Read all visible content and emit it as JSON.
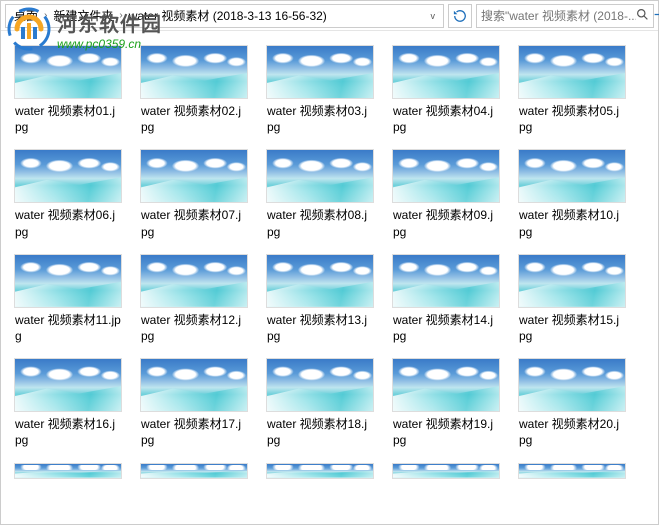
{
  "breadcrumb": {
    "items": [
      "桌面",
      "新建文件夹",
      "water 视频素材 (2018-3-13 16-56-32)"
    ]
  },
  "search": {
    "placeholder": "搜索\"water 视频素材 (2018-..."
  },
  "watermark": {
    "title": "河东软件园",
    "url": "www.pc0359.cn"
  },
  "files": [
    {
      "name": "water 视频素材01.jpg"
    },
    {
      "name": "water 视频素材02.jpg"
    },
    {
      "name": "water 视频素材03.jpg"
    },
    {
      "name": "water 视频素材04.jpg"
    },
    {
      "name": "water 视频素材05.jpg"
    },
    {
      "name": "water 视频素材06.jpg"
    },
    {
      "name": "water 视频素材07.jpg"
    },
    {
      "name": "water 视频素材08.jpg"
    },
    {
      "name": "water 视频素材09.jpg"
    },
    {
      "name": "water 视频素材10.jpg"
    },
    {
      "name": "water 视频素材11.jpg"
    },
    {
      "name": "water 视频素材12.jpg"
    },
    {
      "name": "water 视频素材13.jpg"
    },
    {
      "name": "water 视频素材14.jpg"
    },
    {
      "name": "water 视频素材15.jpg"
    },
    {
      "name": "water 视频素材16.jpg"
    },
    {
      "name": "water 视频素材17.jpg"
    },
    {
      "name": "water 视频素材18.jpg"
    },
    {
      "name": "water 视频素材19.jpg"
    },
    {
      "name": "water 视频素材20.jpg"
    }
  ],
  "overflow_files_visible": 5
}
